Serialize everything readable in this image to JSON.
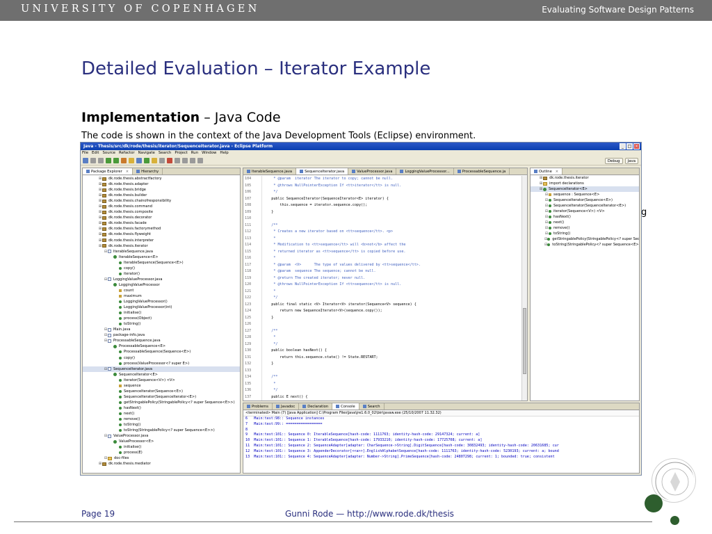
{
  "header": {
    "university": "UNIVERSITY OF COPENHAGEN",
    "course": "Evaluating Software Design Patterns"
  },
  "slide": {
    "title": "Detailed Evaluation – Iterator Example",
    "subheading_bold": "Implementation",
    "subheading_rest": " – Java Code",
    "subline": "The code is shown in the context of the Java Development Tools (Eclipse) environment.",
    "stray_glyph": "g"
  },
  "footer": {
    "page": "Page 19",
    "author": "Gunni Rode — http://www.rode.dk/thesis"
  },
  "eclipse": {
    "window_title": "Java - Thesis/src/dk/rode/thesis/iterator/SequenceIterator.java - Eclipse Platform",
    "window_buttons": [
      "_",
      "□",
      "×"
    ],
    "menu": [
      "File",
      "Edit",
      "Source",
      "Refactor",
      "Navigate",
      "Search",
      "Project",
      "Run",
      "Window",
      "Help"
    ],
    "perspectives": [
      "Debug",
      "Java"
    ],
    "package_explorer": {
      "tabs": [
        "Package Explorer",
        "Hierarchy"
      ],
      "tree": [
        {
          "level": 1,
          "type": "pkg",
          "label": "dk.rode.thesis.abstractfactory"
        },
        {
          "level": 1,
          "type": "pkg",
          "label": "dk.rode.thesis.adapter"
        },
        {
          "level": 1,
          "type": "pkg",
          "label": "dk.rode.thesis.bridge"
        },
        {
          "level": 1,
          "type": "pkg",
          "label": "dk.rode.thesis.builder"
        },
        {
          "level": 1,
          "type": "pkg",
          "label": "dk.rode.thesis.chainofresponsibility"
        },
        {
          "level": 1,
          "type": "pkg",
          "label": "dk.rode.thesis.command"
        },
        {
          "level": 1,
          "type": "pkg",
          "label": "dk.rode.thesis.composite"
        },
        {
          "level": 1,
          "type": "pkg",
          "label": "dk.rode.thesis.decorator"
        },
        {
          "level": 1,
          "type": "pkg",
          "label": "dk.rode.thesis.facade"
        },
        {
          "level": 1,
          "type": "pkg",
          "label": "dk.rode.thesis.factorymethod"
        },
        {
          "level": 1,
          "type": "pkg",
          "label": "dk.rode.thesis.flyweight"
        },
        {
          "level": 1,
          "type": "pkg",
          "label": "dk.rode.thesis.interpreter"
        },
        {
          "level": 1,
          "type": "pkg",
          "label": "dk.rode.thesis.iterator"
        },
        {
          "level": 2,
          "type": "file",
          "label": "IterableSequence.java"
        },
        {
          "level": 3,
          "type": "cls",
          "label": "IterableSequence<E>"
        },
        {
          "level": 4,
          "type": "m-pub",
          "label": "IterableSequence(Sequence<E>)"
        },
        {
          "level": 4,
          "type": "m-pub",
          "label": "copy()"
        },
        {
          "level": 4,
          "type": "m-pub",
          "label": "iterator()"
        },
        {
          "level": 2,
          "type": "file",
          "label": "LoggingValueProcessor.java"
        },
        {
          "level": 3,
          "type": "cls",
          "label": "LoggingValueProcessor"
        },
        {
          "level": 4,
          "type": "field",
          "label": "count"
        },
        {
          "level": 4,
          "type": "field",
          "label": "maximum"
        },
        {
          "level": 4,
          "type": "m-pub",
          "label": "LoggingValueProcessor()"
        },
        {
          "level": 4,
          "type": "m-pub",
          "label": "LoggingValueProcessor(int)"
        },
        {
          "level": 4,
          "type": "m-pub",
          "label": "initialise()"
        },
        {
          "level": 4,
          "type": "m-pub",
          "label": "process(Object)"
        },
        {
          "level": 4,
          "type": "m-pub",
          "label": "toString()"
        },
        {
          "level": 2,
          "type": "file",
          "label": "Main.java"
        },
        {
          "level": 2,
          "type": "file",
          "label": "package-info.java"
        },
        {
          "level": 2,
          "type": "file",
          "label": "ProcessableSequence.java"
        },
        {
          "level": 3,
          "type": "cls",
          "label": "ProcessableSequence<E>"
        },
        {
          "level": 4,
          "type": "m-pub",
          "label": "ProcessableSequence(Sequence<E>)"
        },
        {
          "level": 4,
          "type": "m-pub",
          "label": "copy()"
        },
        {
          "level": 4,
          "type": "m-pub",
          "label": "process(ValueProcessor<? super E>)"
        },
        {
          "level": 2,
          "type": "file",
          "label": "SequenceIterator.java",
          "selected": true
        },
        {
          "level": 3,
          "type": "cls",
          "label": "SequenceIterator<E>"
        },
        {
          "level": 4,
          "type": "m-pub",
          "label": "iterator(Sequence<V>) <V>"
        },
        {
          "level": 4,
          "type": "field",
          "label": "sequence"
        },
        {
          "level": 4,
          "type": "m-pub",
          "label": "SequenceIterator(Sequence<E>)"
        },
        {
          "level": 4,
          "type": "m-pub",
          "label": "SequenceIterator(SequenceIterator<E>)"
        },
        {
          "level": 4,
          "type": "m-pub",
          "label": "getStringablePolicy(StringablePolicy<? super Sequence<E>>)"
        },
        {
          "level": 4,
          "type": "m-pub",
          "label": "hasNext()"
        },
        {
          "level": 4,
          "type": "m-pub",
          "label": "next()"
        },
        {
          "level": 4,
          "type": "m-pub",
          "label": "remove()"
        },
        {
          "level": 4,
          "type": "m-pub",
          "label": "toString()"
        },
        {
          "level": 4,
          "type": "m-pub",
          "label": "toString(StringablePolicy<? super Sequence<E>>)"
        },
        {
          "level": 2,
          "type": "file",
          "label": "ValueProcessor.java"
        },
        {
          "level": 3,
          "type": "cls",
          "label": "ValueProcessor<E>"
        },
        {
          "level": 4,
          "type": "m-pub",
          "label": "initialise()"
        },
        {
          "level": 4,
          "type": "m-pub",
          "label": "process(E)"
        },
        {
          "level": 2,
          "type": "folder",
          "label": "doc-files"
        },
        {
          "level": 1,
          "type": "pkg",
          "label": "dk.rode.thesis.mediator"
        }
      ]
    },
    "editor": {
      "tabs": [
        "IterableSequence.java",
        "SequenceIterator.java",
        "ValueProcessor.java",
        "LoggingValueProcessor...",
        "ProcessableSequence.ja"
      ],
      "active_tab": 1,
      "lines": [
        {
          "n": "104",
          "s": "c",
          "t": "     * @param  iterator The iterator to copy; cannot be null."
        },
        {
          "n": "105",
          "s": "c",
          "t": "     * @throws NullPointerException If <tt>iterator</tt> is null."
        },
        {
          "n": "106",
          "s": "c",
          "t": "     */"
        },
        {
          "n": "107",
          "s": "k",
          "t": "    public SequenceIterator(SequenceIterator<E> iterator) {"
        },
        {
          "n": "108",
          "s": "k",
          "t": "        this.sequence = iterator.sequence.copy();"
        },
        {
          "n": "109",
          "s": "k",
          "t": "    }"
        },
        {
          "n": "110",
          "s": "k",
          "t": ""
        },
        {
          "n": "111",
          "s": "c",
          "t": "    /**"
        },
        {
          "n": "112",
          "s": "c",
          "t": "     * Creates a new iterator based on <tt>sequence</tt>. <p>"
        },
        {
          "n": "113",
          "s": "c",
          "t": "     *"
        },
        {
          "n": "114",
          "s": "c",
          "t": "     * Modification to <tt>sequence</tt> will <b>not</b> affect the"
        },
        {
          "n": "115",
          "s": "c",
          "t": "     * returned iterator as <tt>sequence</tt> is copied before use."
        },
        {
          "n": "116",
          "s": "c",
          "t": "     *"
        },
        {
          "n": "117",
          "s": "c",
          "t": "     * @param  <V>      The type of values delivered by <tt>sequence</tt>."
        },
        {
          "n": "118",
          "s": "c",
          "t": "     * @param  sequence The sequence; cannot be null."
        },
        {
          "n": "119",
          "s": "c",
          "t": "     * @return The created iterator; never null."
        },
        {
          "n": "120",
          "s": "c",
          "t": "     * @throws NullPointerException If <tt>sequence</tt> is null."
        },
        {
          "n": "121",
          "s": "c",
          "t": "     *"
        },
        {
          "n": "122",
          "s": "c",
          "t": "     */"
        },
        {
          "n": "123",
          "s": "k",
          "t": "    public final static <V> Iterator<V> iterator(Sequence<V> sequence) {"
        },
        {
          "n": "124",
          "s": "k",
          "t": "        return new SequenceIterator<V>(sequence.copy());"
        },
        {
          "n": "125",
          "s": "k",
          "t": "    }"
        },
        {
          "n": "126",
          "s": "k",
          "t": ""
        },
        {
          "n": "127",
          "s": "c",
          "t": "    /**"
        },
        {
          "n": "128",
          "s": "c",
          "t": "     *"
        },
        {
          "n": "129",
          "s": "c",
          "t": "     */"
        },
        {
          "n": "130",
          "s": "k",
          "t": "    public boolean hasNext() {"
        },
        {
          "n": "131",
          "s": "k",
          "t": "        return this.sequence.state() != State.RESTART;"
        },
        {
          "n": "132",
          "s": "k",
          "t": "    }"
        },
        {
          "n": "133",
          "s": "k",
          "t": ""
        },
        {
          "n": "134",
          "s": "c",
          "t": "    /**"
        },
        {
          "n": "135",
          "s": "c",
          "t": "     *"
        },
        {
          "n": "136",
          "s": "c",
          "t": "     */"
        },
        {
          "n": "137",
          "s": "k",
          "t": "    public E next() {"
        },
        {
          "n": "138",
          "s": "cm",
          "t": "        // Next actually corresponds to current..."
        },
        {
          "n": "139",
          "s": "k",
          "t": "        E value = this.sequence.current();"
        },
        {
          "n": "140",
          "s": "k",
          "t": "        this.sequence.next();"
        },
        {
          "n": "141",
          "s": "k",
          "t": "        return value;"
        },
        {
          "n": "142",
          "s": "k",
          "t": "    }"
        }
      ]
    },
    "outline": {
      "tabs": [
        "Outline"
      ],
      "rows": [
        {
          "level": 1,
          "type": "pkg",
          "label": "dk.rode.thesis.iterator"
        },
        {
          "level": 1,
          "type": "folder",
          "label": "import declarations"
        },
        {
          "level": 1,
          "type": "cls",
          "label": "SequenceIterator<E>",
          "selected": true
        },
        {
          "level": 2,
          "type": "field",
          "label": "sequence : Sequence<E>"
        },
        {
          "level": 2,
          "type": "m-pub",
          "label": "SequenceIterator(Sequence<E>)"
        },
        {
          "level": 2,
          "type": "m-pub",
          "label": "SequenceIterator(SequenceIterator<E>)"
        },
        {
          "level": 2,
          "type": "m-pub",
          "label": "iterator(Sequence<V>) <V>"
        },
        {
          "level": 2,
          "type": "m-pub",
          "label": "hasNext()"
        },
        {
          "level": 2,
          "type": "m-pub",
          "label": "next()"
        },
        {
          "level": 2,
          "type": "m-pub",
          "label": "remove()"
        },
        {
          "level": 2,
          "type": "m-pub",
          "label": "toString()"
        },
        {
          "level": 2,
          "type": "m-pub",
          "label": "getStringablePolicy(StringablePolicy<? super Sequen"
        },
        {
          "level": 2,
          "type": "m-pub",
          "label": "toString(StringablePolicy<? super Sequence<E>>)"
        }
      ]
    },
    "console": {
      "tabs": [
        "Problems",
        "Javadoc",
        "Declaration",
        "Console",
        "Search"
      ],
      "active_tab": 3,
      "terminated": "<terminated> Main (7) [Java Application] C:\\Program Files\\Java\\jre1.6.0_02\\bin\\javaw.exe (25/10/2007 11.32.32)",
      "lines": [
        "6   Main:test:98:: Sequence instances",
        "7   Main:test:99:: =================",
        "8",
        "9   Main:test:101:: Sequence 0: IterableSequence[hash-code: 1111763; identity-hash-code: 29147324; current: a]",
        "10  Main:test:101:: Sequence 1: IterableSequence[hash-code: 17933210; identity-hash-code: 17725708; current: a]",
        "11  Main:test:101:: Sequence 2: SequenceAdapter[adapter: CharSequence->String].DigitSequence[hash-code: 30832493; identity-hash-code: 20631685; cur",
        "12  Main:test:101:: Sequence 3: AppenderDecorator[<<a>>].EnglishAlphabetSequence[hash-code: 1111763; identity-hash-code: 5230193; current: a; bound",
        "13  Main:test:101:: Sequence 4: SequenceAdapter[adapter: Number->String].PrimeSequence[hash-code: 24807298; current: 1; bounded: true; consistent"
      ]
    }
  }
}
